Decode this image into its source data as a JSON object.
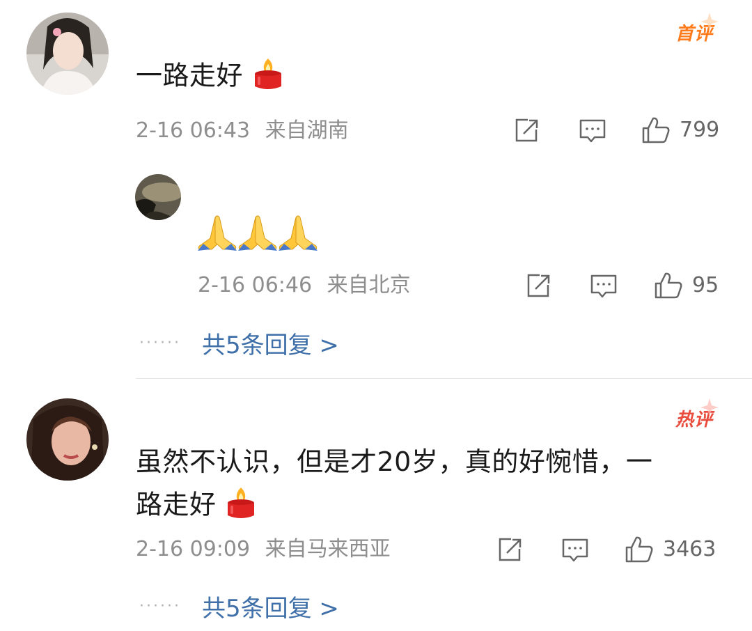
{
  "comments": [
    {
      "badge": "首评",
      "text": "一路走好",
      "emoji": "candle-emoji",
      "date": "2-16 06:43",
      "location": "来自湖南",
      "likes": "799",
      "nested": {
        "text": "",
        "emoji": "pray-emoji x3",
        "date": "2-16 06:46",
        "location": "来自北京",
        "likes": "95"
      },
      "replies_label": "共5条回复 >"
    },
    {
      "badge": "热评",
      "text_line1": "虽然不认识，但是才20岁，真的好惋惜，一",
      "text_line2": "路走好",
      "emoji": "candle-emoji",
      "date": "2-16 09:09",
      "location": "来自马来西亚",
      "likes": "3463",
      "replies_label": "共5条回复 >"
    }
  ],
  "dots": "······",
  "colors": {
    "badge_first": "#ff7a1a",
    "badge_hot": "#e94b3c",
    "link": "#3e6fa8",
    "meta": "#8e8e8e"
  }
}
